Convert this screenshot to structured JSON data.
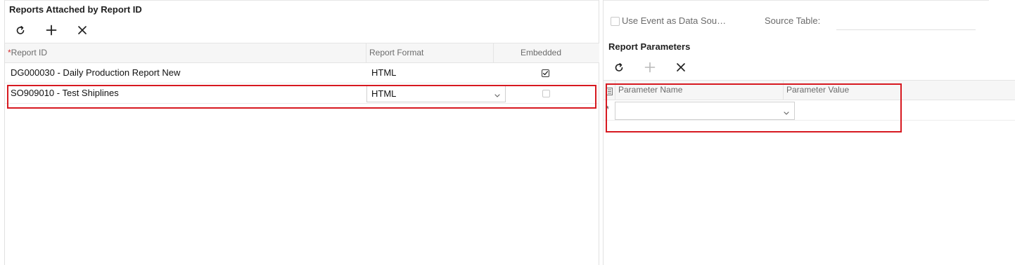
{
  "left": {
    "title": "Reports Attached by Report ID",
    "toolbar": {
      "refresh_icon": "refresh-icon",
      "add_icon": "plus-icon",
      "delete_icon": "close-icon"
    },
    "columns": {
      "report_id": "Report ID",
      "report_format": "Report Format",
      "embedded": "Embedded"
    },
    "required_marker": "*",
    "rows": [
      {
        "report_id": "DG000030 - Daily Production Report New",
        "format": "HTML",
        "embedded": true
      },
      {
        "report_id": "SO909010 - Test Shiplines",
        "format": "HTML",
        "embedded": false
      }
    ]
  },
  "right": {
    "use_event_label": "Use Event as Data Sou…",
    "use_event_checked": false,
    "source_table_label": "Source Table:",
    "source_table_value": "",
    "title": "Report Parameters",
    "toolbar": {
      "refresh_icon": "refresh-icon",
      "add_icon": "plus-icon",
      "delete_icon": "close-icon"
    },
    "columns": {
      "parameter_name": "Parameter Name",
      "parameter_value": "Parameter Value"
    },
    "new_row_marker": "*",
    "new_row": {
      "parameter_name": "",
      "parameter_value": ""
    }
  },
  "highlight_color": "#d71920"
}
